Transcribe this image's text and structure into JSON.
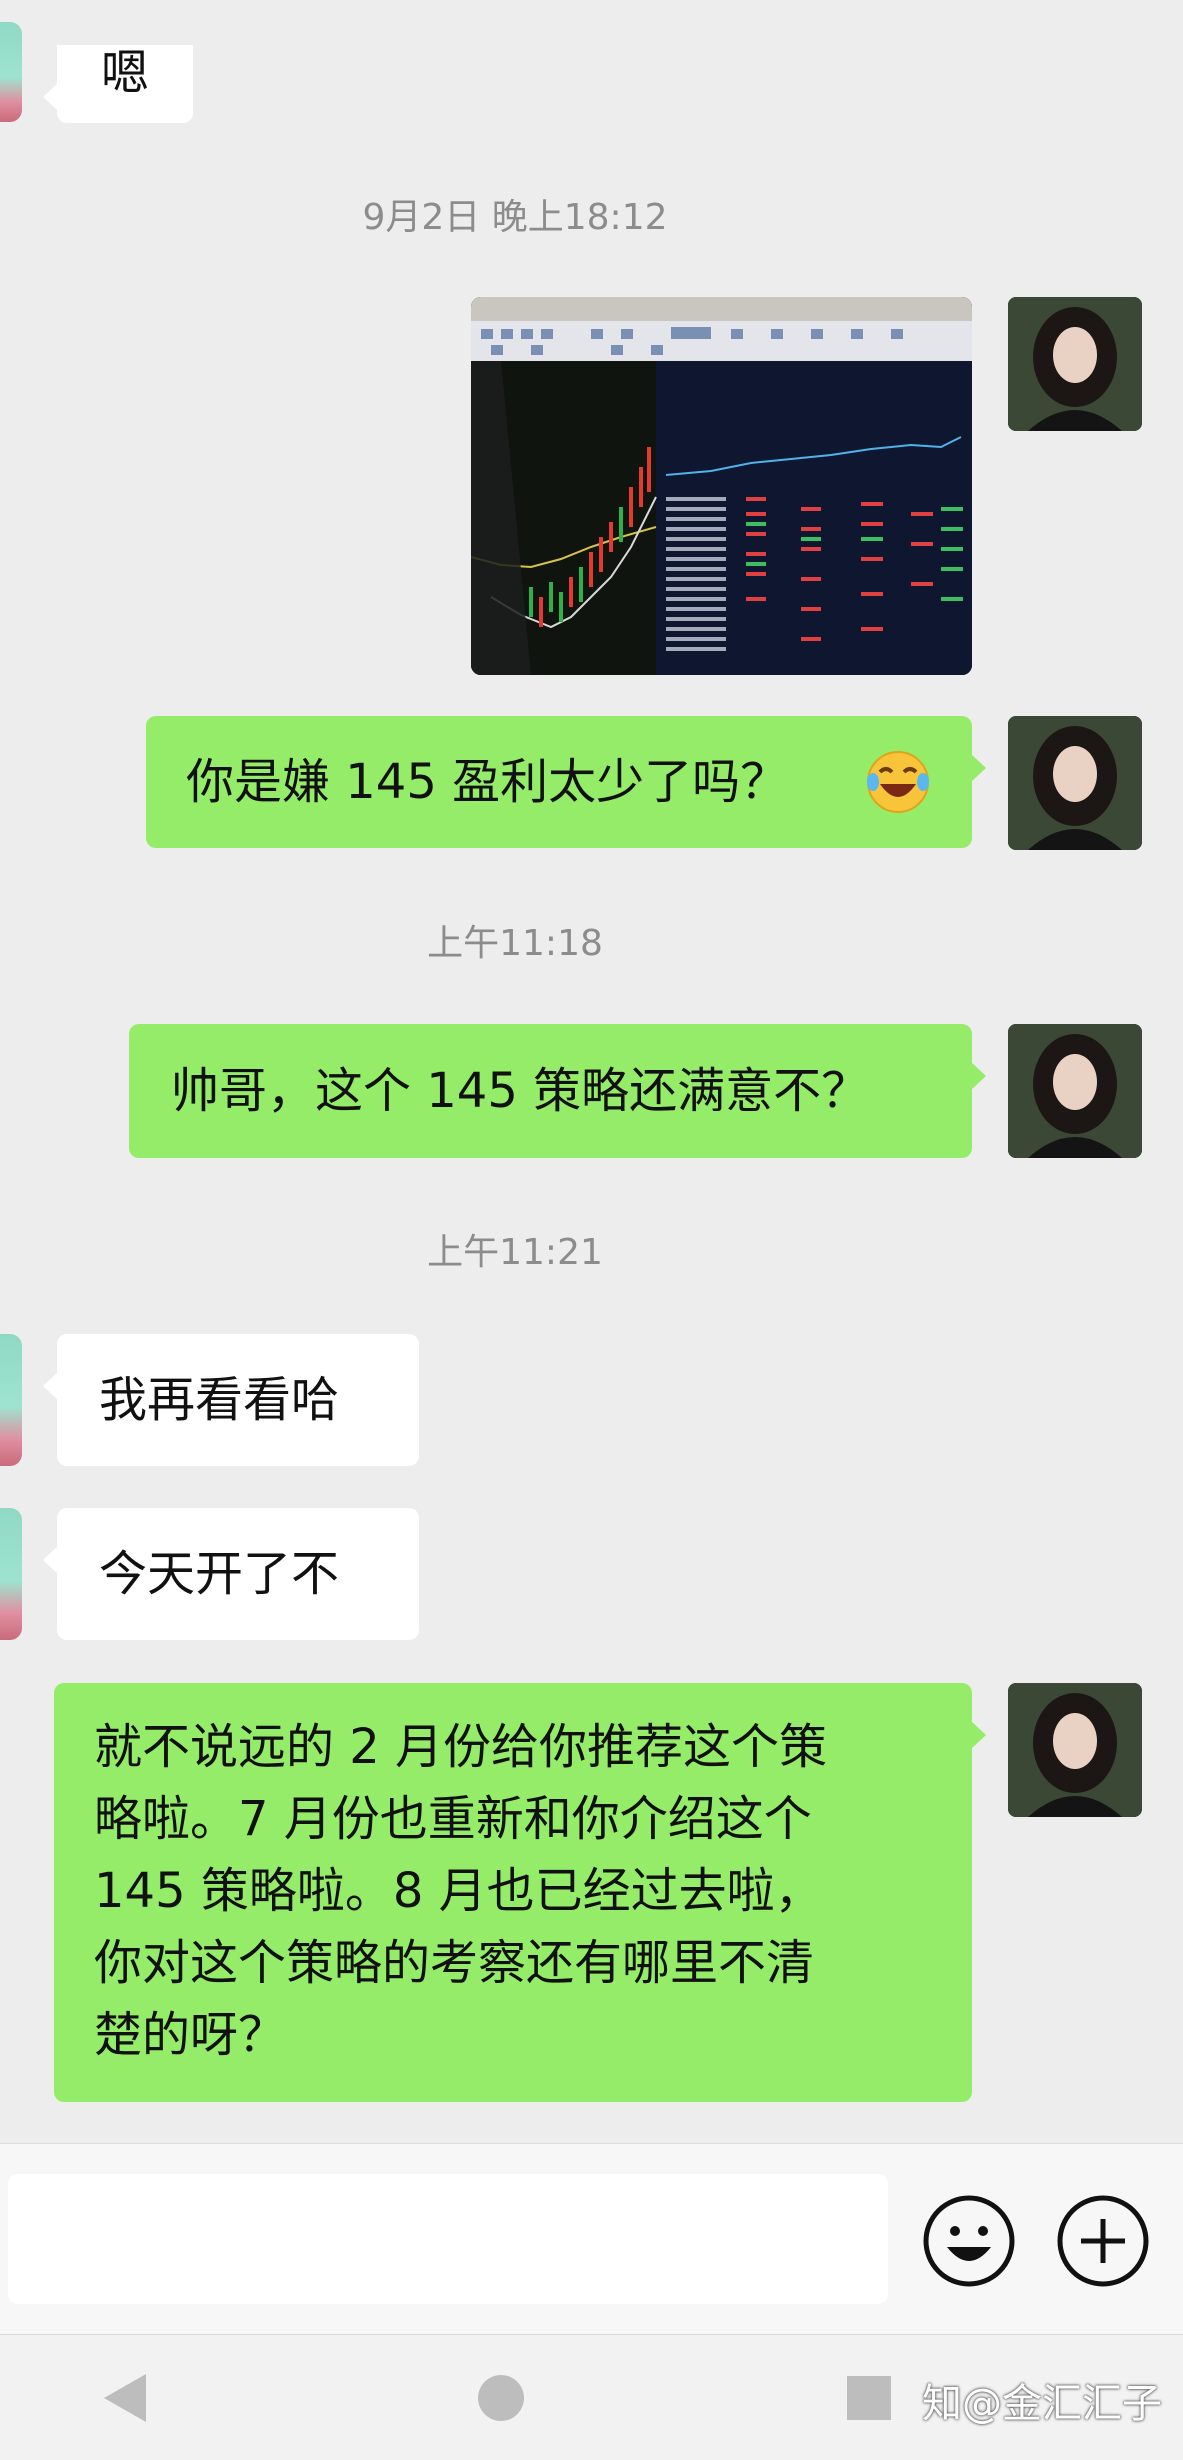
{
  "chat": {
    "top_message": "嗯",
    "timestamp1": "9月2日 晚上18:12",
    "msg_question_profit": "你是嫌 145 盈利太少了吗？",
    "emoji_icon": "face-with-tears-of-joy-icon",
    "timestamp2": "上午11:18",
    "msg_satisfied": "帅哥，这个 145 策略还满意不？",
    "timestamp3": "上午11:21",
    "msg_look_again": "我再看看哈",
    "msg_opened_today": "今天开了不",
    "msg_long_lines": [
      "就不说远的 2 月份给你推荐这个策",
      "略啦。7 月份也重新和你介绍这个",
      "145 策略啦。8 月也已经过去啦，",
      "你对这个策略的考察还有哪里不清",
      "楚的呀？"
    ]
  },
  "input": {
    "value": "",
    "emoji_button_icon": "smiley-icon",
    "plus_button_icon": "plus-circle-icon"
  },
  "nav": {
    "back_icon": "back-triangle-icon",
    "home_icon": "home-circle-icon",
    "recents_icon": "recents-square-icon"
  },
  "watermark": "知@金汇汇子",
  "colors": {
    "background": "#ededed",
    "outgoing_bubble": "#95ec69",
    "incoming_bubble": "#ffffff",
    "timestamp_text": "#8c8c8c"
  }
}
